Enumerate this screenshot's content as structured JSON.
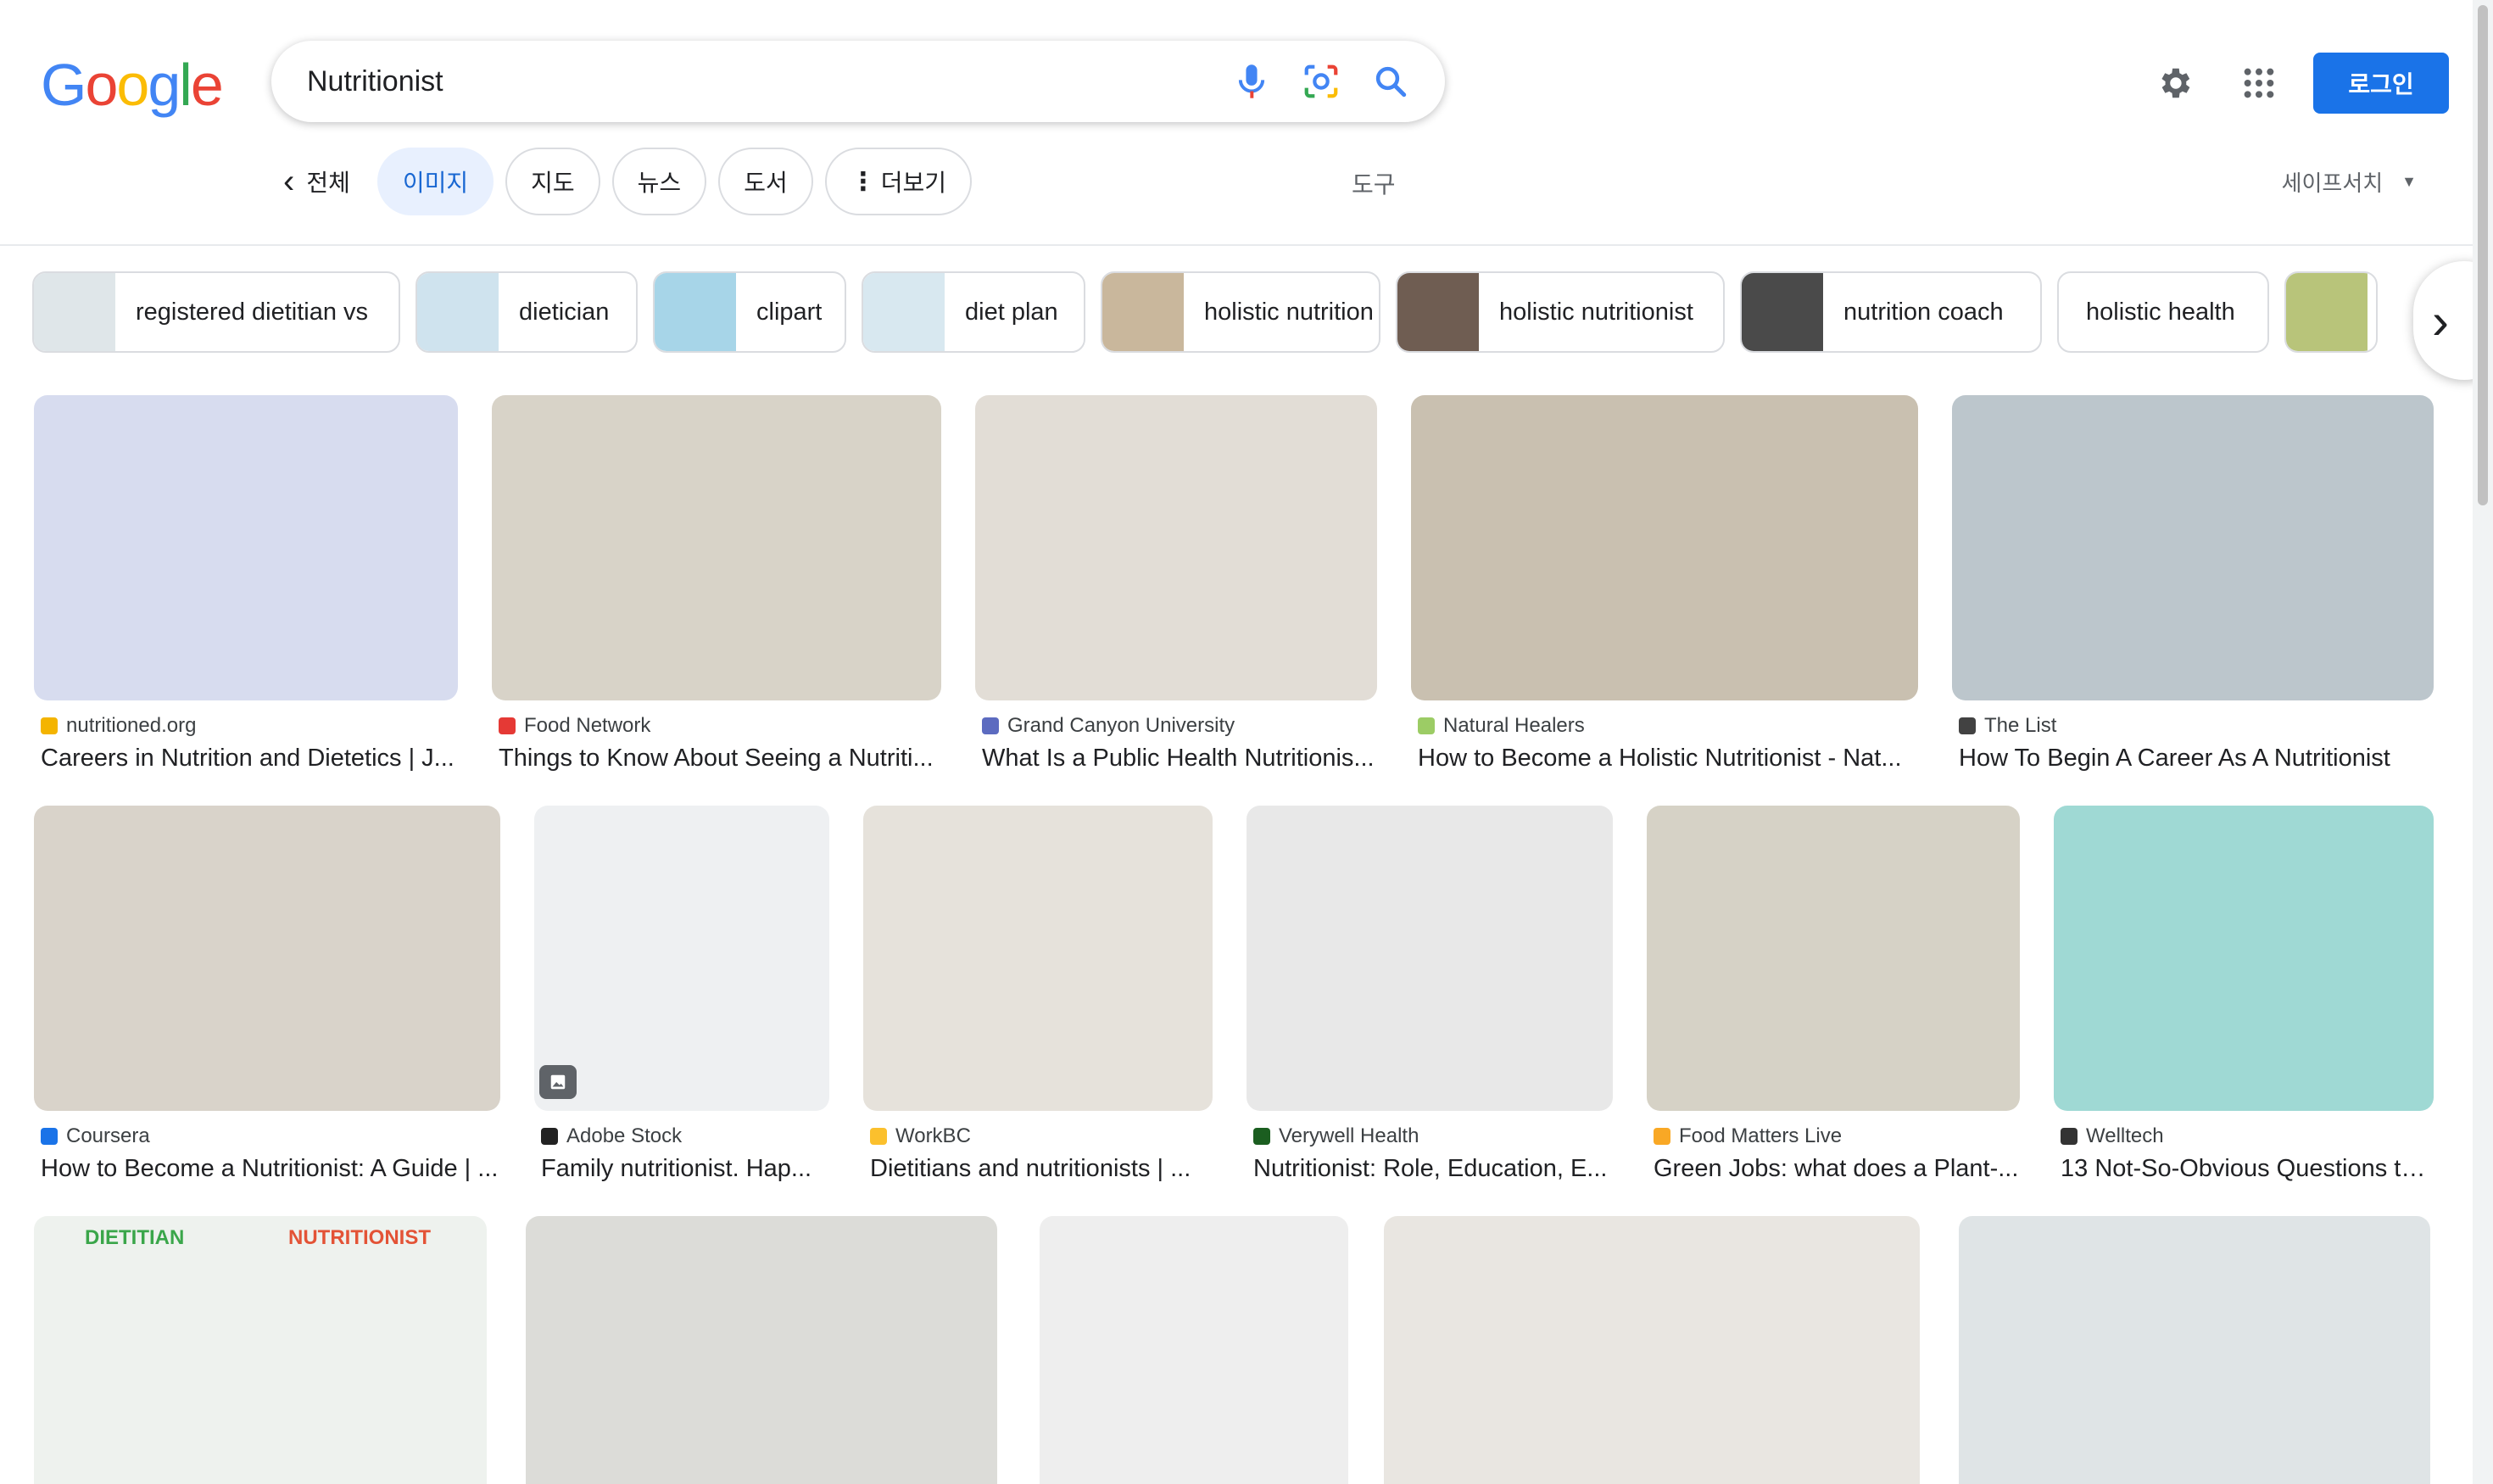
{
  "logo": {
    "text": [
      "G",
      "o",
      "o",
      "g",
      "l",
      "e"
    ],
    "colors": [
      "#4285F4",
      "#EA4335",
      "#FBBC05",
      "#4285F4",
      "#34A853",
      "#EA4335"
    ]
  },
  "search": {
    "query": "Nutritionist"
  },
  "header": {
    "login_label": "로그인"
  },
  "tabs": {
    "back_label": "전체",
    "items": [
      "이미지",
      "지도",
      "뉴스",
      "도서"
    ],
    "more_label": "더보기",
    "tools_label": "도구",
    "safesearch_label": "세이프서치"
  },
  "related": [
    {
      "label": "registered dietitian vs",
      "thumb_color": "#dfe6e9"
    },
    {
      "label": "dietician",
      "thumb_color": "#cfe3ee"
    },
    {
      "label": "clipart",
      "thumb_color": "#a7d5e8"
    },
    {
      "label": "diet plan",
      "thumb_color": "#d8e8f0"
    },
    {
      "label": "holistic nutrition",
      "thumb_color": "#c9b79c"
    },
    {
      "label": "holistic nutritionist",
      "thumb_color": "#6f5d52"
    },
    {
      "label": "nutrition coach",
      "thumb_color": "#4a4a4a"
    },
    {
      "label": "holistic health",
      "thumb_color": ""
    },
    {
      "label": "",
      "thumb_color": "#b8c47a"
    }
  ],
  "results": [
    {
      "source": "nutritioned.org",
      "title": "Careers in Nutrition and Dietetics | J...",
      "fav": "#f4b400",
      "bg": "#d7dcef"
    },
    {
      "source": "Food Network",
      "title": "Things to Know About Seeing a Nutriti...",
      "fav": "#e53935",
      "bg": "#d8d3c8"
    },
    {
      "source": "Grand Canyon University",
      "title": "What Is a Public Health Nutritionis...",
      "fav": "#5c6bc0",
      "bg": "#e2ddd6"
    },
    {
      "source": "Natural Healers",
      "title": "How to Become a Holistic Nutritionist - Nat...",
      "fav": "#9ccc65",
      "bg": "#c9c0b0"
    },
    {
      "source": "The List",
      "title": "How To Begin A Career As A Nutritionist",
      "fav": "#424242",
      "bg": "#bcc6cc"
    },
    {
      "source": "Coursera",
      "title": "How to Become a Nutritionist: A Guide | ...",
      "fav": "#1a73e8",
      "bg": "#d9d3ca"
    },
    {
      "source": "Adobe Stock",
      "title": "Family nutritionist. Hap...",
      "fav": "#222222",
      "bg": "#eef0f2"
    },
    {
      "source": "WorkBC",
      "title": "Dietitians and nutritionists | ...",
      "fav": "#fbc02d",
      "bg": "#e6e2db"
    },
    {
      "source": "Verywell Health",
      "title": "Nutritionist: Role, Education, E...",
      "fav": "#1b5e20",
      "bg": "#e8e8e8"
    },
    {
      "source": "Food Matters Live",
      "title": "Green Jobs: what does a Plant-...",
      "fav": "#f9a825",
      "bg": "#d6d2c6"
    },
    {
      "source": "Welltech",
      "title": "13 Not-So-Obvious Questions to...",
      "fav": "#333333",
      "bg": "#9fd9d4"
    }
  ],
  "bottom_row": [
    {
      "bg": "#eef2ee",
      "left_heading": "DIETITIAN",
      "right_heading": "NUTRITIONIST"
    },
    {
      "bg": "#dcdcd8"
    },
    {
      "bg": "#eeeeee"
    },
    {
      "bg": "#e9e6e1"
    },
    {
      "bg": "#dfe4e6"
    }
  ]
}
